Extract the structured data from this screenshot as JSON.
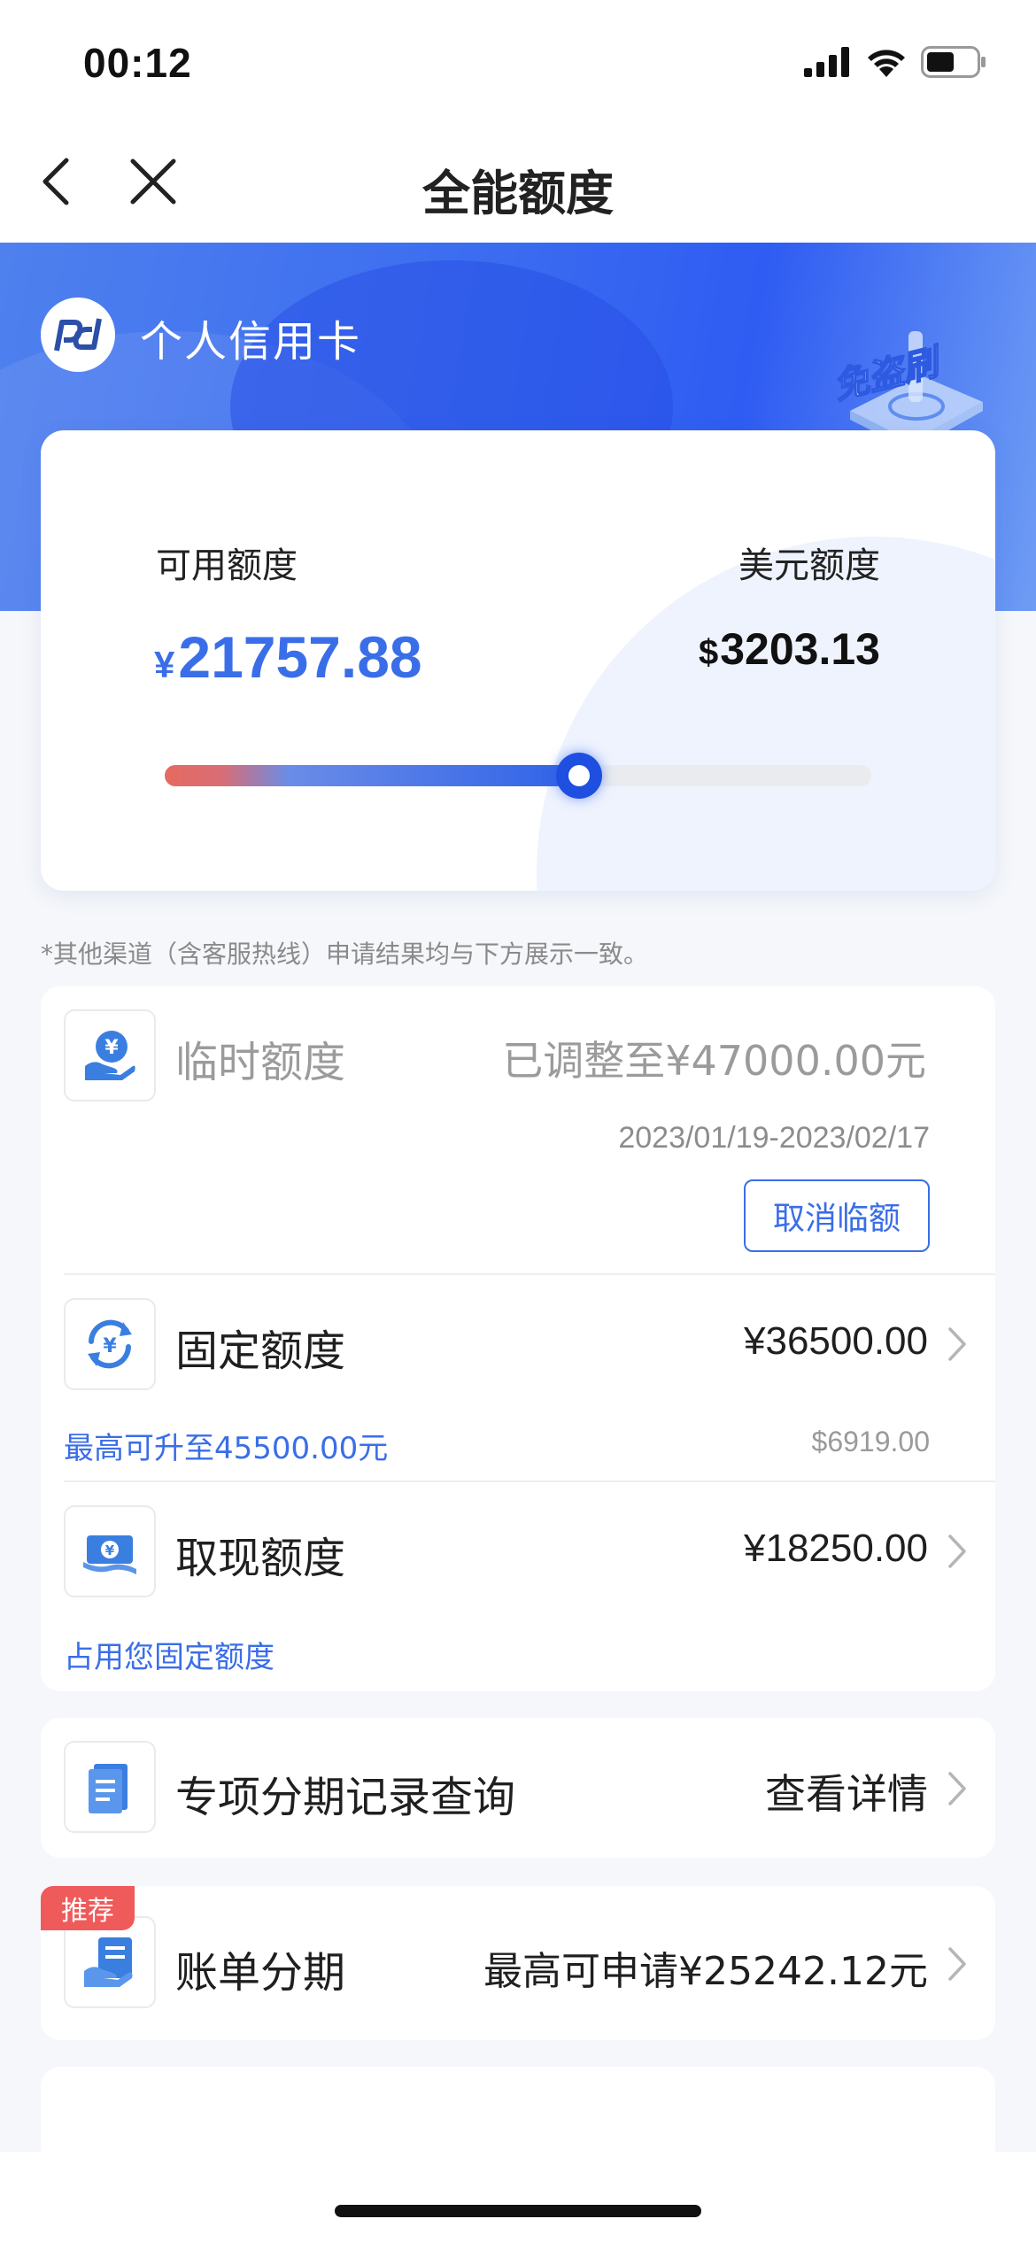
{
  "status_bar": {
    "time": "00:12",
    "icons": [
      "cellular-signal-icon",
      "wifi-icon",
      "battery-icon"
    ]
  },
  "nav": {
    "title": "全能额度",
    "icons": [
      "back-arrow-icon",
      "close-icon"
    ]
  },
  "banner": {
    "brand_name": "个人信用卡",
    "brand_icon": "bank-logo-icon",
    "badge_text": "免盗刷"
  },
  "credit_summary": {
    "available_label": "可用额度",
    "available_currency": "¥",
    "available_amount": "21757.88",
    "usd_label": "美元额度",
    "usd_currency": "$",
    "usd_amount": "3203.13",
    "usage_slider_fraction": 0.586
  },
  "notice_text": "*其他渠道（含客服热线）申请结果均与下方展示一致。",
  "limits": {
    "temporary": {
      "title": "临时额度",
      "status": "已调整至¥47000.00元",
      "date_range": "2023/01/19-2023/02/17",
      "cancel_label": "取消临额",
      "icon": "hand-yuan-icon"
    },
    "fixed": {
      "title": "固定额度",
      "amount": "¥36500.00",
      "note": "最高可升至45500.00元",
      "usd_amount": "$6919.00",
      "icon": "yuan-cycle-icon"
    },
    "cash": {
      "title": "取现额度",
      "amount": "¥18250.00",
      "note": "占用您固定额度",
      "icon": "banknote-icon"
    }
  },
  "installment_records": {
    "title": "专项分期记录查询",
    "action": "查看详情",
    "icon": "document-list-icon"
  },
  "bill_installment": {
    "tag": "推荐",
    "title": "账单分期",
    "detail": "最高可申请¥25242.12元",
    "icon": "receipt-hand-icon"
  },
  "colors": {
    "accent_blue": "#3a6ee8",
    "banner_blue": "#3b6cf0",
    "tag_red": "#ef5a5a"
  }
}
